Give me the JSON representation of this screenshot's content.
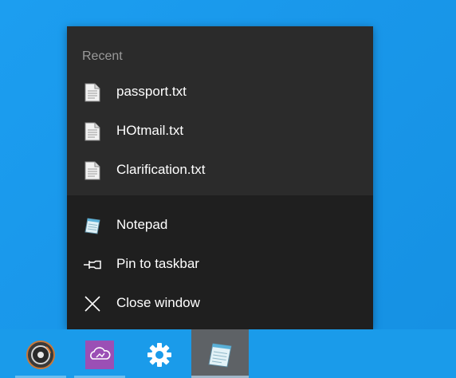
{
  "jumplist": {
    "recent_header": "Recent",
    "recent_items": [
      {
        "label": "passport.txt",
        "icon": "text-file-icon"
      },
      {
        "label": "HOtmail.txt",
        "icon": "text-file-icon"
      },
      {
        "label": "Clarification.txt",
        "icon": "text-file-icon"
      }
    ],
    "tasks": [
      {
        "label": "Notepad",
        "icon": "notepad-icon"
      },
      {
        "label": "Pin to taskbar",
        "icon": "pin-icon"
      },
      {
        "label": "Close window",
        "icon": "close-icon"
      }
    ]
  },
  "taskbar": {
    "buttons": [
      {
        "icon": "groove-music-icon",
        "active": false
      },
      {
        "icon": "onenote-cloud-icon",
        "active": false
      },
      {
        "icon": "settings-gear-icon",
        "active": false
      },
      {
        "icon": "notepad-icon",
        "active": true
      }
    ]
  },
  "colors": {
    "desktop": "#1a9bea",
    "jumplist_recent_bg": "#2b2b2b",
    "jumplist_tasks_bg": "#1f1f1f",
    "header_text": "#9a9a9a",
    "item_text": "#ffffff",
    "active_taskbar_bg": "#5e6266"
  }
}
